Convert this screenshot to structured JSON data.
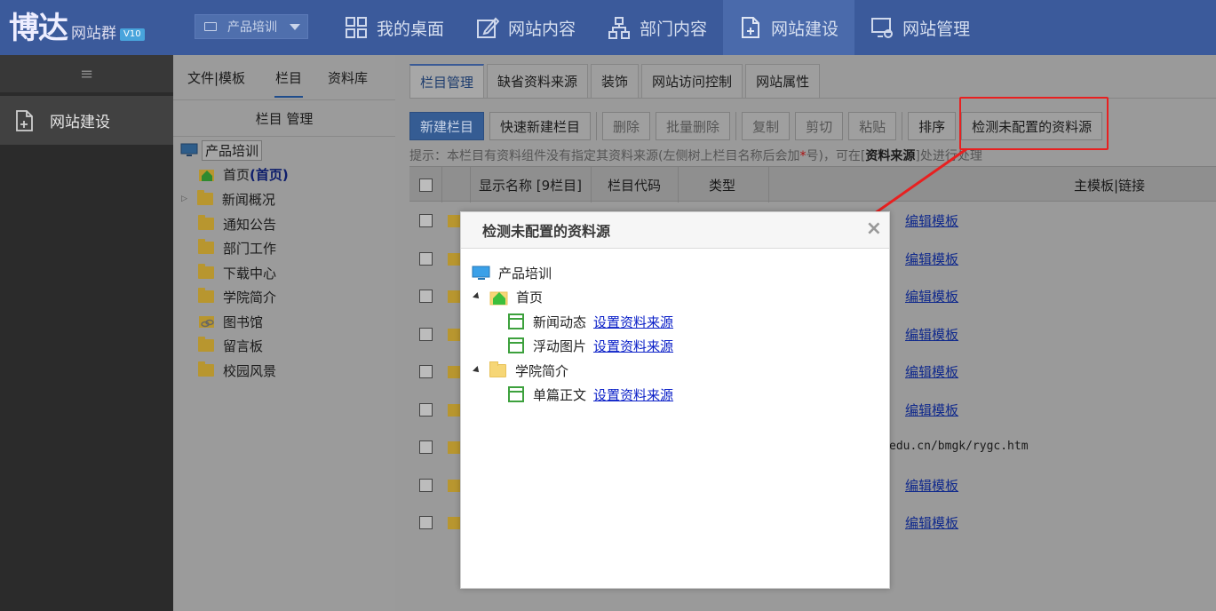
{
  "header": {
    "logo_main": "博达",
    "logo_sub": "网站群",
    "logo_version": "V10",
    "site_select": "产品培训",
    "nav": [
      "我的桌面",
      "网站内容",
      "部门内容",
      "网站建设",
      "网站管理"
    ],
    "active_nav": "网站建设"
  },
  "sidebar": {
    "collapse_icon": "≡",
    "active_item": "网站建设"
  },
  "tree_panel": {
    "tabs": [
      "文件|模板",
      "栏目",
      "资料库"
    ],
    "active_tab": "栏目",
    "header": "栏目 管理",
    "root": "产品培训",
    "home": "首页",
    "home_tag": "(首页)",
    "items": [
      "新闻概况",
      "通知公告",
      "部门工作",
      "下载中心",
      "学院简介",
      "图书馆",
      "留言板",
      "校园风景"
    ]
  },
  "main": {
    "tabs": [
      "栏目管理",
      "缺省资料来源",
      "装饰",
      "网站访问控制",
      "网站属性"
    ],
    "toolbar": {
      "new_column": "新建栏目",
      "quick_new": "快速新建栏目",
      "delete": "删除",
      "batch_delete": "批量删除",
      "copy": "复制",
      "cut": "剪切",
      "paste": "粘贴",
      "sort": "排序",
      "detect": "检测未配置的资料源"
    },
    "hint_pre": "提示：本栏目有资料组件没有指定其资料来源(左侧树上栏目名称后会加",
    "hint_star": "*",
    "hint_mid": "号)，可在[",
    "hint_bold": "资料来源",
    "hint_post": "]处进行处理",
    "table_headers": {
      "name": "显示名称 [9栏目]",
      "code": "栏目代码",
      "type": "类型",
      "template": "主模板|链接"
    },
    "rows": [
      "编辑模板",
      "编辑模板",
      "编辑模板",
      "编辑模板",
      "编辑模板",
      "编辑模板",
      "edu.cn/bmgk/rygc.htm",
      "编辑模板",
      "编辑模板"
    ]
  },
  "modal": {
    "title": "检测未配置的资料源",
    "close": "×",
    "root": "产品培训",
    "home": "首页",
    "set_link": "设置资料来源",
    "home_children": [
      "新闻动态",
      "浮动图片"
    ],
    "college": "学院简介",
    "college_children": [
      "单篇正文"
    ]
  },
  "colors": {
    "topbar": "#3b5a9b",
    "primary_button": "#355c93",
    "highlight": "#e82020",
    "link": "#0b20c8"
  }
}
